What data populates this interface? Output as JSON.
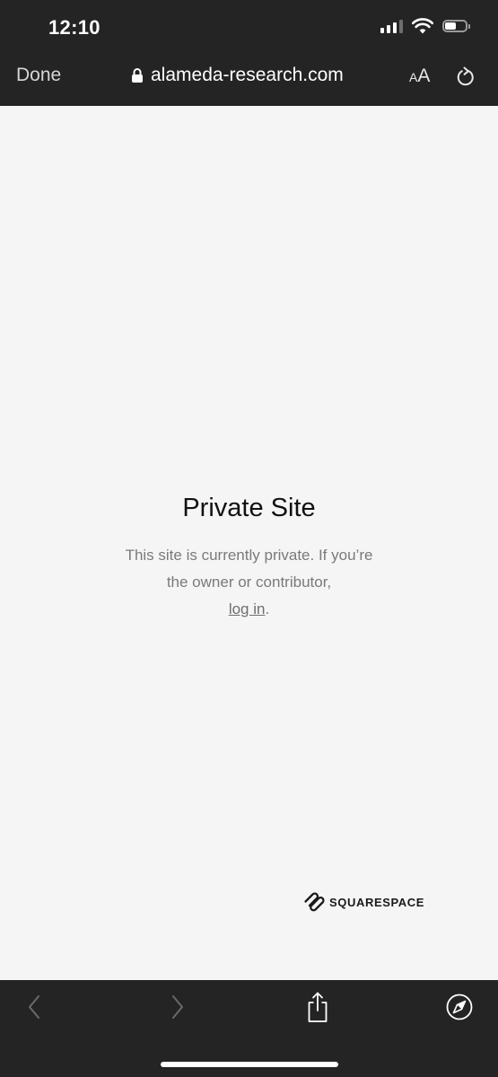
{
  "status_bar": {
    "time": "12:10",
    "battery_level": 0.55
  },
  "browser": {
    "done_label": "Done",
    "url": "alameda-research.com",
    "text_size_small": "A",
    "text_size_large": "A"
  },
  "page": {
    "title": "Private Site",
    "message": "This site is currently private. If you’re the owner or contributor,",
    "login_link": "log in",
    "message_end": "."
  },
  "branding": {
    "label": "SQUARESPACE"
  },
  "colors": {
    "chrome_background": "#242424",
    "page_background": "#f5f5f5",
    "title_text": "#111111",
    "body_text": "#7a7a7a"
  }
}
